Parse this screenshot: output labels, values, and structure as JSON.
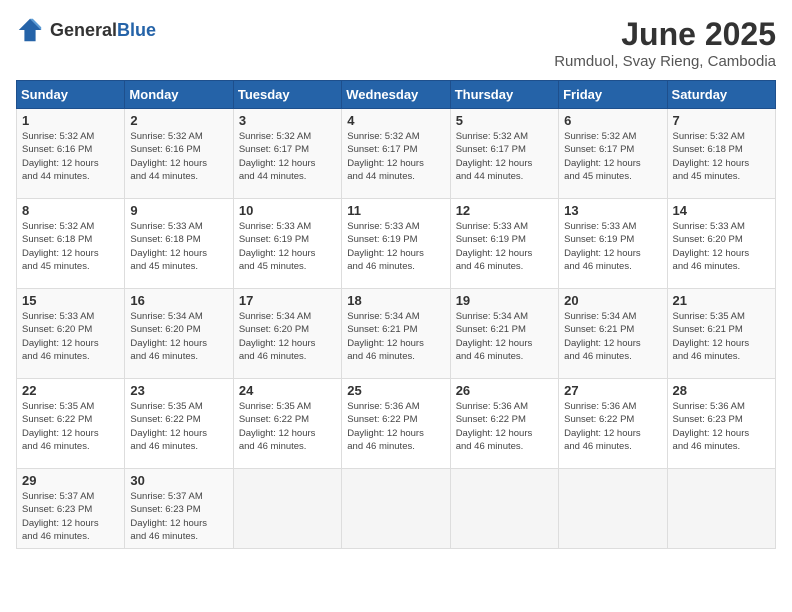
{
  "header": {
    "logo_general": "General",
    "logo_blue": "Blue",
    "title": "June 2025",
    "location": "Rumduol, Svay Rieng, Cambodia"
  },
  "days_of_week": [
    "Sunday",
    "Monday",
    "Tuesday",
    "Wednesday",
    "Thursday",
    "Friday",
    "Saturday"
  ],
  "weeks": [
    [
      {
        "day": "1",
        "sunrise": "5:32 AM",
        "sunset": "6:16 PM",
        "daylight": "12 hours and 44 minutes."
      },
      {
        "day": "2",
        "sunrise": "5:32 AM",
        "sunset": "6:16 PM",
        "daylight": "12 hours and 44 minutes."
      },
      {
        "day": "3",
        "sunrise": "5:32 AM",
        "sunset": "6:17 PM",
        "daylight": "12 hours and 44 minutes."
      },
      {
        "day": "4",
        "sunrise": "5:32 AM",
        "sunset": "6:17 PM",
        "daylight": "12 hours and 44 minutes."
      },
      {
        "day": "5",
        "sunrise": "5:32 AM",
        "sunset": "6:17 PM",
        "daylight": "12 hours and 44 minutes."
      },
      {
        "day": "6",
        "sunrise": "5:32 AM",
        "sunset": "6:17 PM",
        "daylight": "12 hours and 45 minutes."
      },
      {
        "day": "7",
        "sunrise": "5:32 AM",
        "sunset": "6:18 PM",
        "daylight": "12 hours and 45 minutes."
      }
    ],
    [
      {
        "day": "8",
        "sunrise": "5:32 AM",
        "sunset": "6:18 PM",
        "daylight": "12 hours and 45 minutes."
      },
      {
        "day": "9",
        "sunrise": "5:33 AM",
        "sunset": "6:18 PM",
        "daylight": "12 hours and 45 minutes."
      },
      {
        "day": "10",
        "sunrise": "5:33 AM",
        "sunset": "6:19 PM",
        "daylight": "12 hours and 45 minutes."
      },
      {
        "day": "11",
        "sunrise": "5:33 AM",
        "sunset": "6:19 PM",
        "daylight": "12 hours and 46 minutes."
      },
      {
        "day": "12",
        "sunrise": "5:33 AM",
        "sunset": "6:19 PM",
        "daylight": "12 hours and 46 minutes."
      },
      {
        "day": "13",
        "sunrise": "5:33 AM",
        "sunset": "6:19 PM",
        "daylight": "12 hours and 46 minutes."
      },
      {
        "day": "14",
        "sunrise": "5:33 AM",
        "sunset": "6:20 PM",
        "daylight": "12 hours and 46 minutes."
      }
    ],
    [
      {
        "day": "15",
        "sunrise": "5:33 AM",
        "sunset": "6:20 PM",
        "daylight": "12 hours and 46 minutes."
      },
      {
        "day": "16",
        "sunrise": "5:34 AM",
        "sunset": "6:20 PM",
        "daylight": "12 hours and 46 minutes."
      },
      {
        "day": "17",
        "sunrise": "5:34 AM",
        "sunset": "6:20 PM",
        "daylight": "12 hours and 46 minutes."
      },
      {
        "day": "18",
        "sunrise": "5:34 AM",
        "sunset": "6:21 PM",
        "daylight": "12 hours and 46 minutes."
      },
      {
        "day": "19",
        "sunrise": "5:34 AM",
        "sunset": "6:21 PM",
        "daylight": "12 hours and 46 minutes."
      },
      {
        "day": "20",
        "sunrise": "5:34 AM",
        "sunset": "6:21 PM",
        "daylight": "12 hours and 46 minutes."
      },
      {
        "day": "21",
        "sunrise": "5:35 AM",
        "sunset": "6:21 PM",
        "daylight": "12 hours and 46 minutes."
      }
    ],
    [
      {
        "day": "22",
        "sunrise": "5:35 AM",
        "sunset": "6:22 PM",
        "daylight": "12 hours and 46 minutes."
      },
      {
        "day": "23",
        "sunrise": "5:35 AM",
        "sunset": "6:22 PM",
        "daylight": "12 hours and 46 minutes."
      },
      {
        "day": "24",
        "sunrise": "5:35 AM",
        "sunset": "6:22 PM",
        "daylight": "12 hours and 46 minutes."
      },
      {
        "day": "25",
        "sunrise": "5:36 AM",
        "sunset": "6:22 PM",
        "daylight": "12 hours and 46 minutes."
      },
      {
        "day": "26",
        "sunrise": "5:36 AM",
        "sunset": "6:22 PM",
        "daylight": "12 hours and 46 minutes."
      },
      {
        "day": "27",
        "sunrise": "5:36 AM",
        "sunset": "6:22 PM",
        "daylight": "12 hours and 46 minutes."
      },
      {
        "day": "28",
        "sunrise": "5:36 AM",
        "sunset": "6:23 PM",
        "daylight": "12 hours and 46 minutes."
      }
    ],
    [
      {
        "day": "29",
        "sunrise": "5:37 AM",
        "sunset": "6:23 PM",
        "daylight": "12 hours and 46 minutes."
      },
      {
        "day": "30",
        "sunrise": "5:37 AM",
        "sunset": "6:23 PM",
        "daylight": "12 hours and 46 minutes."
      },
      null,
      null,
      null,
      null,
      null
    ]
  ],
  "labels": {
    "sunrise": "Sunrise:",
    "sunset": "Sunset:",
    "daylight": "Daylight:"
  }
}
